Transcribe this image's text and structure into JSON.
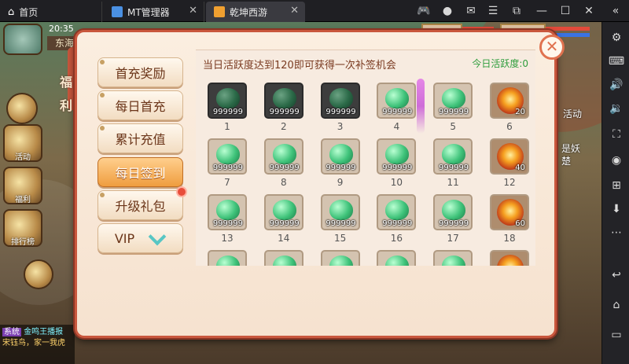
{
  "titlebar": {
    "tabs": [
      {
        "label": "首页",
        "icon": "home-icon",
        "color": "#ffffff"
      },
      {
        "label": "MT管理器",
        "icon": "mt-manager-icon",
        "color": "#4a90e2"
      },
      {
        "label": "乾坤西游",
        "icon": "game-app-icon",
        "color": "#f0a030"
      }
    ],
    "controls": [
      "gamepad-icon",
      "account-icon",
      "mail-icon",
      "menu-icon",
      "external-link-icon",
      "minimize-icon",
      "maximize-icon",
      "close-icon",
      "collapse-icon"
    ]
  },
  "sidebar_buttons": [
    "settings-icon",
    "keyboard-icon",
    "volume-up-icon",
    "volume-down-icon",
    "screenshot-icon",
    "record-icon",
    "add-window-icon",
    "apk-install-icon",
    "more-icon",
    "back-icon",
    "home-icon",
    "recent-apps-icon"
  ],
  "game": {
    "time": "20:35",
    "map_name": "东海渔村",
    "left_icons": [
      "活动",
      "福利",
      "排行榜"
    ],
    "right_texts": [
      "活动",
      "是妖",
      "楚"
    ],
    "chat": {
      "tag": "系统",
      "line1": "金鸣王播报",
      "line2": "宋钰鸟，家一我虎"
    }
  },
  "modal": {
    "side_label": "福利",
    "close_symbol": "✕",
    "menu": [
      {
        "label": "首充奖励",
        "active": false,
        "badge": false
      },
      {
        "label": "每日首充",
        "active": false,
        "badge": false
      },
      {
        "label": "累计充值",
        "active": false,
        "badge": false
      },
      {
        "label": "每日签到",
        "active": true,
        "badge": false
      },
      {
        "label": "升级礼包",
        "active": false,
        "badge": true
      },
      {
        "label": "VIP",
        "active": false,
        "badge": false,
        "chevron": true
      }
    ],
    "tip": "当日活跃度达到120即可获得一次补签机会",
    "activity": "今日活跃度:0",
    "days": [
      {
        "day": "1",
        "item": "jade",
        "qty": "999999",
        "state": "dark"
      },
      {
        "day": "2",
        "item": "jade",
        "qty": "999999",
        "state": "dark"
      },
      {
        "day": "3",
        "item": "jade",
        "qty": "999999",
        "state": "dark"
      },
      {
        "day": "4",
        "item": "jade",
        "qty": "999999",
        "state": "normal"
      },
      {
        "day": "5",
        "item": "jade",
        "qty": "999999",
        "state": "normal"
      },
      {
        "day": "6",
        "item": "fire",
        "qty": "20",
        "state": "normal"
      },
      {
        "day": "7",
        "item": "jade",
        "qty": "999999",
        "state": "normal"
      },
      {
        "day": "8",
        "item": "jade",
        "qty": "999999",
        "state": "normal"
      },
      {
        "day": "9",
        "item": "jade",
        "qty": "999999",
        "state": "normal"
      },
      {
        "day": "10",
        "item": "jade",
        "qty": "999999",
        "state": "normal"
      },
      {
        "day": "11",
        "item": "jade",
        "qty": "999999",
        "state": "normal"
      },
      {
        "day": "12",
        "item": "fire",
        "qty": "40",
        "state": "normal"
      },
      {
        "day": "13",
        "item": "jade",
        "qty": "999999",
        "state": "normal"
      },
      {
        "day": "14",
        "item": "jade",
        "qty": "999999",
        "state": "normal"
      },
      {
        "day": "15",
        "item": "jade",
        "qty": "999999",
        "state": "normal"
      },
      {
        "day": "16",
        "item": "jade",
        "qty": "999999",
        "state": "normal"
      },
      {
        "day": "17",
        "item": "jade",
        "qty": "999999",
        "state": "normal"
      },
      {
        "day": "18",
        "item": "fire",
        "qty": "60",
        "state": "normal"
      },
      {
        "day": "",
        "item": "jade",
        "qty": "",
        "state": "normal"
      },
      {
        "day": "",
        "item": "jade",
        "qty": "",
        "state": "normal"
      },
      {
        "day": "",
        "item": "jade",
        "qty": "",
        "state": "normal"
      },
      {
        "day": "",
        "item": "jade",
        "qty": "",
        "state": "normal"
      },
      {
        "day": "",
        "item": "jade",
        "qty": "",
        "state": "normal"
      },
      {
        "day": "",
        "item": "fire",
        "qty": "",
        "state": "normal"
      }
    ]
  }
}
